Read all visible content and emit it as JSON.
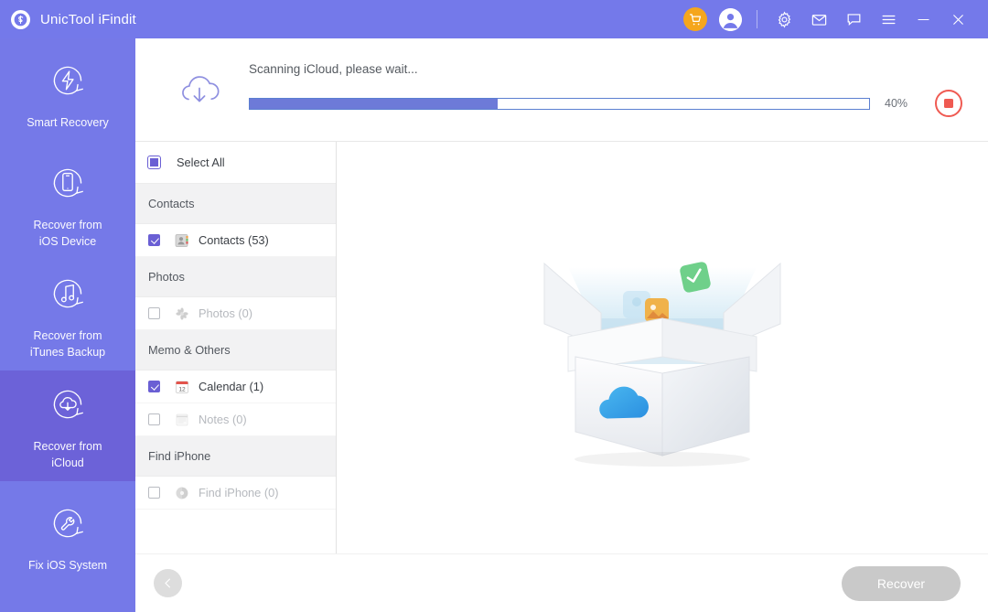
{
  "titlebar": {
    "app_name": "UnicTool iFindit",
    "logo_icon": "unictool-logo-icon",
    "icons": [
      {
        "name": "cart-icon",
        "glyph": "shopping-cart"
      },
      {
        "name": "account-icon",
        "glyph": "user-avatar"
      },
      {
        "name": "settings-icon",
        "glyph": "gear"
      },
      {
        "name": "mail-icon",
        "glyph": "envelope"
      },
      {
        "name": "feedback-icon",
        "glyph": "chat-bubble"
      },
      {
        "name": "menu-icon",
        "glyph": "hamburger"
      },
      {
        "name": "minimize-icon",
        "glyph": "minus"
      },
      {
        "name": "close-icon",
        "glyph": "cross"
      }
    ]
  },
  "sidebar": {
    "items": [
      {
        "label": "Smart Recovery",
        "icon": "smart-recovery-icon",
        "active": false
      },
      {
        "label": "Recover from\niOS Device",
        "icon": "ios-device-icon",
        "active": false
      },
      {
        "label": "Recover from\niTunes Backup",
        "icon": "itunes-backup-icon",
        "active": false
      },
      {
        "label": "Recover from\niCloud",
        "icon": "icloud-icon",
        "active": true
      },
      {
        "label": "Fix iOS System",
        "icon": "fix-system-icon",
        "active": false
      }
    ]
  },
  "progress": {
    "status_text": "Scanning iCloud, please wait...",
    "percent_label": "40%",
    "percent_value": 40,
    "cloud_icon": "cloud-download-icon",
    "stop_button": "stop-scan-button",
    "fill_color": "#6d7ad8",
    "track_border_color": "#5b7fd1",
    "stop_color": "#ef5a52"
  },
  "list": {
    "select_all_label": "Select All",
    "groups": [
      {
        "header": "Contacts",
        "rows": [
          {
            "label": "Contacts (53)",
            "checked": true,
            "enabled": true,
            "icon": "contacts-icon"
          }
        ]
      },
      {
        "header": "Photos",
        "rows": [
          {
            "label": "Photos (0)",
            "checked": false,
            "enabled": false,
            "icon": "photos-icon"
          }
        ]
      },
      {
        "header": "Memo & Others",
        "rows": [
          {
            "label": "Calendar (1)",
            "checked": true,
            "enabled": true,
            "icon": "calendar-icon"
          },
          {
            "label": "Notes (0)",
            "checked": false,
            "enabled": false,
            "icon": "notes-icon"
          }
        ]
      },
      {
        "header": "Find iPhone",
        "rows": [
          {
            "label": "Find iPhone (0)",
            "checked": false,
            "enabled": false,
            "icon": "find-iphone-icon"
          }
        ]
      }
    ]
  },
  "preview": {
    "illustration": "open-box-with-icloud-logo"
  },
  "bottom": {
    "back_icon": "back-arrow-icon",
    "recover_label": "Recover",
    "recover_enabled": false
  },
  "colors": {
    "brand_purple": "#7479ea",
    "sidebar_purple": "#7579e8",
    "active_purple": "#6c62d8",
    "checkbox_purple": "#6a5fd4",
    "cart_orange": "#f5a61d",
    "stop_red": "#ef5a52",
    "disabled_gray": "#c9c9c9"
  }
}
